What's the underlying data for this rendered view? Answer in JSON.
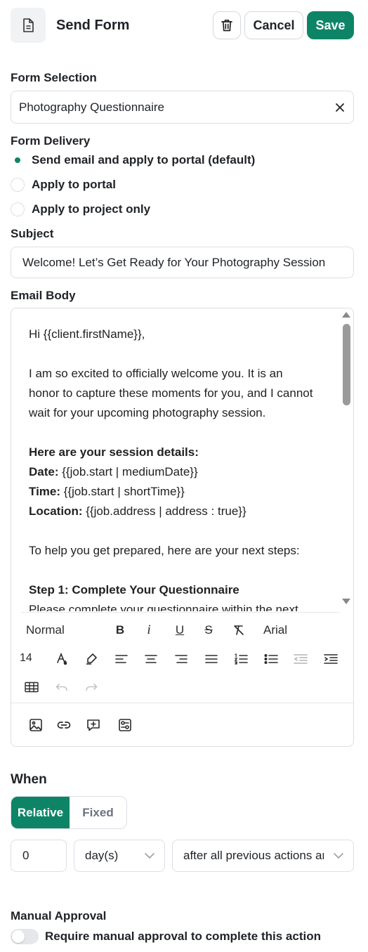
{
  "header": {
    "title": "Send Form",
    "cancel_label": "Cancel",
    "save_label": "Save",
    "accent_color": "#0e8467"
  },
  "form_selection": {
    "label": "Form Selection",
    "value": "Photography Questionnaire"
  },
  "form_delivery": {
    "label": "Form Delivery",
    "options": [
      {
        "label": "Send email and apply to portal (default)",
        "selected": true
      },
      {
        "label": "Apply to portal",
        "selected": false
      },
      {
        "label": "Apply to project only",
        "selected": false
      }
    ]
  },
  "subject": {
    "label": "Subject",
    "value": "Welcome! Let’s Get Ready for Your Photography Session"
  },
  "email_body": {
    "label": "Email Body",
    "lines": [
      {
        "text": "Hi {{client.firstName}},"
      },
      {
        "text": ""
      },
      {
        "text": "I am so excited to officially welcome you. It is an"
      },
      {
        "text": "honor to capture these moments for you, and I cannot"
      },
      {
        "text": "wait for your upcoming photography session."
      },
      {
        "text": ""
      },
      {
        "bold": "Here are your session details:"
      },
      {
        "bold": "Date:",
        "text": " {{job.start | mediumDate}}"
      },
      {
        "bold": "Time:",
        "text": " {{job.start | shortTime}}"
      },
      {
        "bold": "Location:",
        "text": " {{job.address | address : true}}"
      },
      {
        "text": ""
      },
      {
        "text": "To help you get prepared, here are your next steps:"
      },
      {
        "text": ""
      },
      {
        "bold": "Step 1: Complete Your Questionnaire"
      },
      {
        "text": "Please complete your questionnaire within the next"
      }
    ],
    "toolbar": {
      "style": "Normal",
      "font": "Arial",
      "size": "14"
    }
  },
  "when": {
    "label": "When",
    "mode_options": [
      "Relative",
      "Fixed"
    ],
    "selected_mode": "Relative",
    "amount": "0",
    "unit": "day(s)",
    "relation": "after all previous actions are completed"
  },
  "manual_approval": {
    "label": "Manual Approval",
    "toggle_label": "Require manual approval to complete this action",
    "enabled": false
  }
}
